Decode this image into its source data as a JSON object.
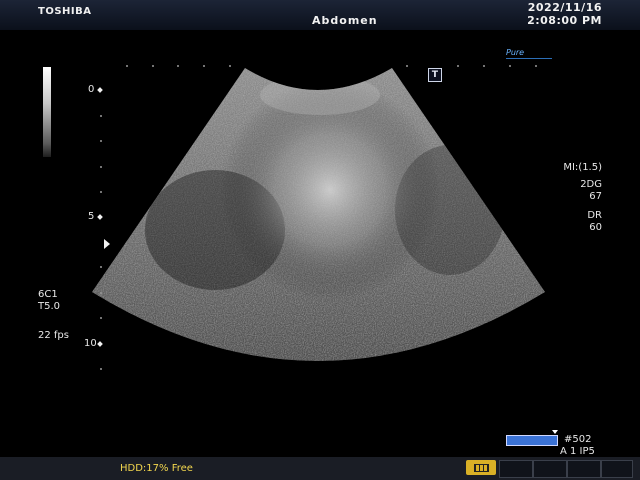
{
  "header": {
    "brand": "TOSHIBA",
    "exam": "Abdomen",
    "date": "2022/11/16",
    "time": "2:08:00 PM"
  },
  "logo": {
    "text": "Pure"
  },
  "trapezoid_icon": "T",
  "depth_labels": [
    "0",
    "5",
    "10"
  ],
  "right_params": {
    "mi": "MI:(1.5)",
    "gain_label": "2DG",
    "gain_value": "67",
    "dr_label": "DR",
    "dr_value": "60"
  },
  "left_params": {
    "probe": "6C1",
    "freq": "T5.0",
    "fps": "22 fps"
  },
  "cine": {
    "frame": "#502",
    "sub": "A 1   IP5"
  },
  "footer": {
    "hdd": "HDD:17% Free"
  },
  "colors": {
    "header_bg": "#121a2a",
    "hdd_text": "#f2d64e",
    "cine_bar": "#3b73d6",
    "tab_active": "#d9b026"
  },
  "icons": [
    "grayscale-bar",
    "trapezoid-icon",
    "focus-marker-icon",
    "cine-icon"
  ]
}
